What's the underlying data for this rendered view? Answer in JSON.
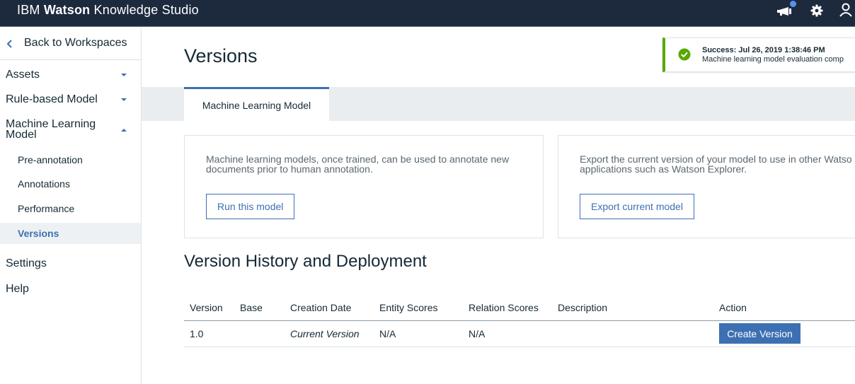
{
  "header": {
    "brand_part1": "IBM",
    "brand_part2": "Watson",
    "brand_part3": "Knowledge Studio",
    "icons": [
      "announcement-icon",
      "settings-icon",
      "user-icon"
    ],
    "background_color": "#1d2a3e"
  },
  "sidebar": {
    "back_label": "Back to Workspaces",
    "sections": [
      {
        "label": "Assets",
        "expanded": false
      },
      {
        "label": "Rule-based Model",
        "expanded": false
      },
      {
        "label_line1": "Machine Learning",
        "label_line2": "Model",
        "expanded": true,
        "items": [
          {
            "label": "Pre-annotation",
            "active": false
          },
          {
            "label": "Annotations",
            "active": false
          },
          {
            "label": "Performance",
            "active": false
          },
          {
            "label": "Versions",
            "active": true
          }
        ]
      }
    ],
    "settings_label": "Settings",
    "help_label": "Help"
  },
  "main": {
    "title": "Versions",
    "tabs": [
      {
        "label": "Machine Learning Model",
        "selected": true
      }
    ],
    "cards": [
      {
        "text_line1": "Machine learning models, once trained, can be used to annotate new",
        "text_line2": "documents prior to human annotation.",
        "button_label": "Run this model"
      },
      {
        "text_line1": "Export the current version of your model to use in other Watso",
        "text_line2": "applications such as Watson Explorer.",
        "button_label": "Export current model"
      }
    ],
    "section_title": "Version History and Deployment",
    "table": {
      "columns": [
        "Version",
        "Base",
        "Creation Date",
        "Entity Scores",
        "Relation Scores",
        "Description",
        "Action"
      ],
      "rows": [
        {
          "version": "1.0",
          "base": "",
          "creation_date": "Current Version",
          "entity_scores": "N/A",
          "relation_scores": "N/A",
          "description": "",
          "action_label": "Create Version"
        }
      ]
    }
  },
  "toast": {
    "title": "Success: Jul 26, 2019 1:38:46 PM",
    "message": "Machine learning model evaluation comp",
    "status_color": "#5aa700"
  },
  "colors": {
    "accent": "#3d70b2",
    "success": "#5aa700",
    "notification_dot": "#5a8ff6"
  }
}
